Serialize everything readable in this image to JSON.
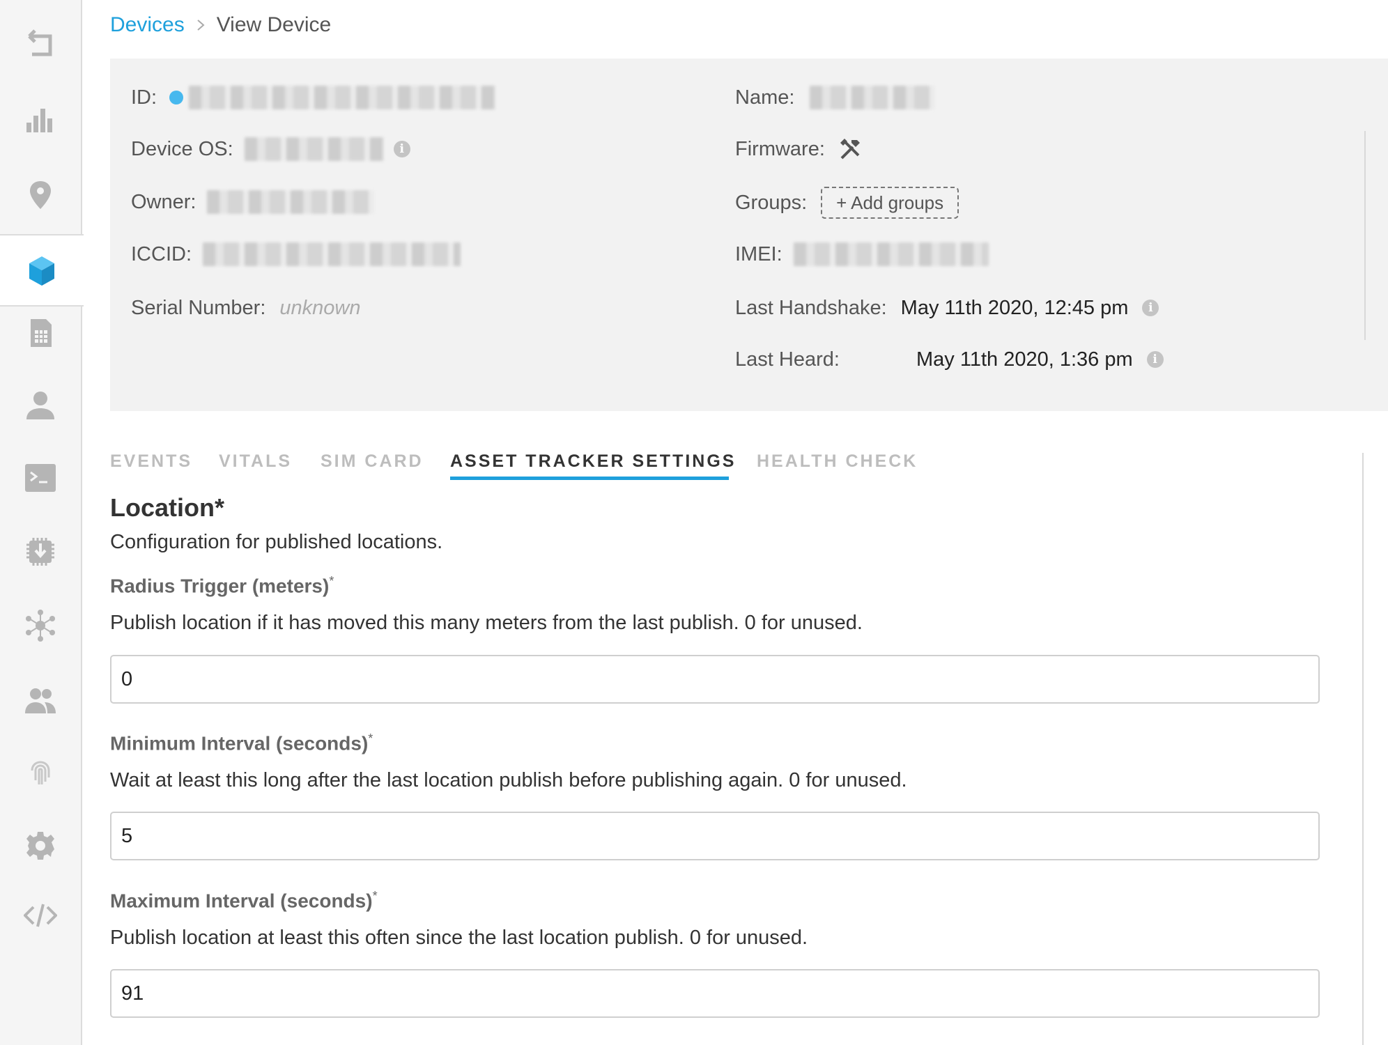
{
  "sidebar": {
    "items": [
      {
        "icon": "back-icon"
      },
      {
        "icon": "bar-chart-icon"
      },
      {
        "icon": "location-pin-icon"
      },
      {
        "icon": "device-cube-icon",
        "active": true
      },
      {
        "icon": "sim-card-icon"
      },
      {
        "icon": "user-icon"
      },
      {
        "icon": "terminal-icon"
      },
      {
        "icon": "firmware-chip-icon"
      },
      {
        "icon": "integrations-hub-icon"
      },
      {
        "icon": "team-icon"
      },
      {
        "icon": "fingerprint-icon"
      },
      {
        "icon": "settings-gear-icon"
      },
      {
        "icon": "code-icon"
      }
    ],
    "accent_color": "#1ea0dc"
  },
  "breadcrumb": {
    "parent": "Devices",
    "current": "View Device"
  },
  "device": {
    "id_label": "ID:",
    "status_color": "#47b8ee",
    "name_label": "Name:",
    "os_label": "Device OS:",
    "firmware_label": "Firmware:",
    "owner_label": "Owner:",
    "groups_label": "Groups:",
    "add_groups_label": "+ Add groups",
    "iccid_label": "ICCID:",
    "imei_label": "IMEI:",
    "serial_label": "Serial Number:",
    "serial_value": "unknown",
    "last_handshake_label": "Last Handshake:",
    "last_handshake_value": "May 11th 2020, 12:45 pm",
    "last_heard_label": "Last Heard:",
    "last_heard_value": "May 11th 2020, 1:36 pm",
    "info_glyph": "i"
  },
  "tabs": [
    {
      "label": "EVENTS",
      "active": false
    },
    {
      "label": "VITALS",
      "active": false
    },
    {
      "label": "SIM CARD",
      "active": false
    },
    {
      "label": "ASSET TRACKER SETTINGS",
      "active": true
    },
    {
      "label": "HEALTH CHECK",
      "active": false
    }
  ],
  "form": {
    "section_title": "Location*",
    "section_description": "Configuration for published locations.",
    "required_mark": "*",
    "fields": [
      {
        "label": "Radius Trigger (meters)",
        "help": "Publish location if it has moved this many meters from the last publish. 0 for unused.",
        "value": "0"
      },
      {
        "label": "Minimum Interval (seconds)",
        "help": "Wait at least this long after the last location publish before publishing again. 0 for unused.",
        "value": "5"
      },
      {
        "label": "Maximum Interval (seconds)",
        "help": "Publish location at least this often since the last location publish. 0 for unused.",
        "value": "91"
      }
    ]
  }
}
